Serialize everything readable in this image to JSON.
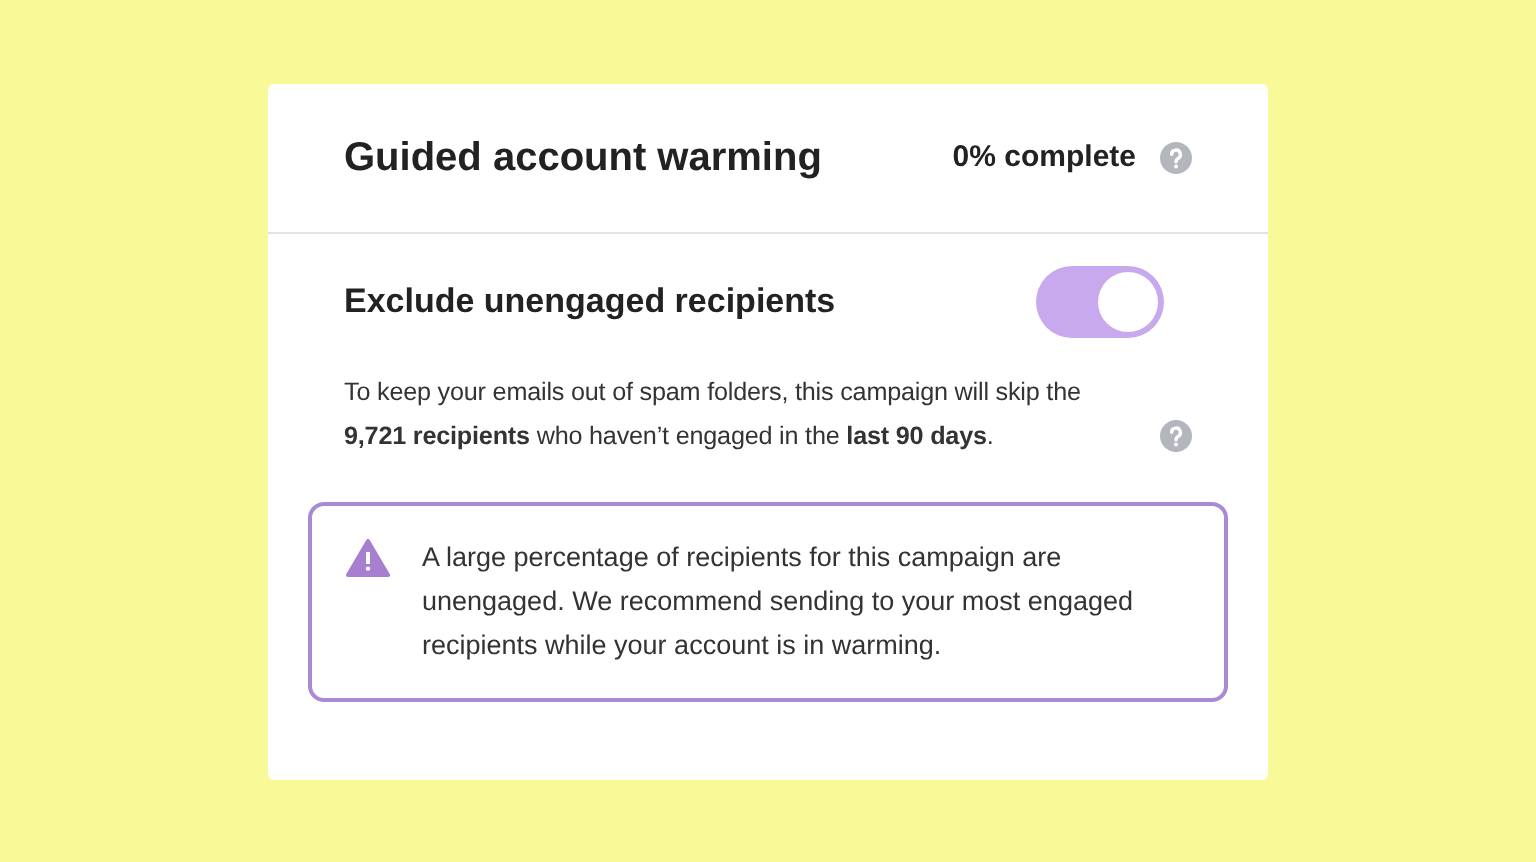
{
  "card": {
    "title": "Guided account warming",
    "progress": "0% complete"
  },
  "setting": {
    "label": "Exclude unengaged recipients",
    "on": true,
    "description": "To keep your emails out of spam folders, this campaign will skip the **9,721 recipients** who haven’t engaged in the **last 90 days**."
  },
  "alert": {
    "kind": "warning",
    "message": "A large percentage of recipients for this campaign are unengaged. We recommend sending to your most engaged recipients while your account is in warming."
  }
}
